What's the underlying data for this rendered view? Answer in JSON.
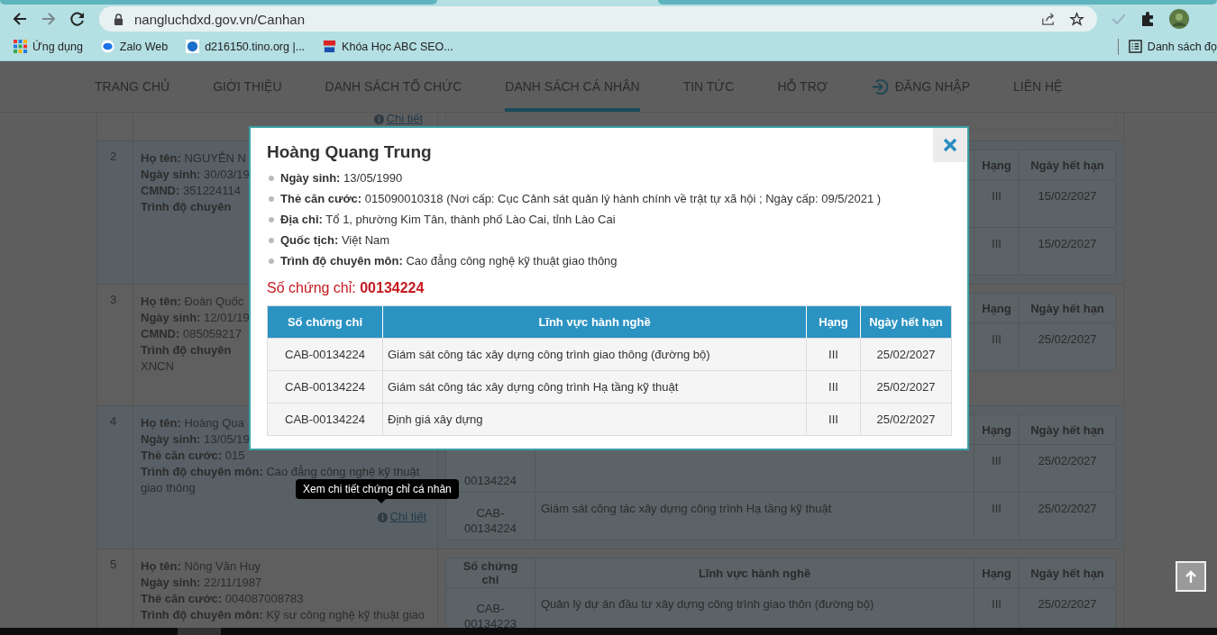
{
  "browser": {
    "url": "nangluchdxd.gov.vn/Canhan",
    "bookmarks": [
      {
        "label": "Ứng dụng",
        "kind": "apps"
      },
      {
        "label": "Zalo Web",
        "kind": "chat"
      },
      {
        "label": "d216150.tino.org |...",
        "kind": "site"
      },
      {
        "label": "Khóa Học ABC SEO...",
        "kind": "course"
      }
    ],
    "reading_list": "Danh sách đọ"
  },
  "nav": [
    {
      "label": "TRANG CHỦ",
      "selected": false
    },
    {
      "label": "GIỚI THIỆU",
      "selected": false
    },
    {
      "label": "DANH SÁCH TỔ CHỨC",
      "selected": false
    },
    {
      "label": "DANH SÁCH CÁ NHÂN",
      "selected": true
    },
    {
      "label": "TIN TỨC",
      "selected": false
    },
    {
      "label": "HỖ TRỢ",
      "selected": false
    },
    {
      "label": "ĐĂNG NHẬP",
      "selected": false,
      "kind": "login"
    },
    {
      "label": "LIÊN HỆ",
      "selected": false
    }
  ],
  "people": [
    {
      "link": "Chi tiết"
    },
    {
      "index": "2",
      "info": [
        "**Họ tên:** NGUYỄN N",
        "**Ngày sinh:** 30/03/19",
        "**CMND:** 351224114",
        "**Trình độ chuyên**"
      ],
      "certs": {
        "headers": {
          "grade": "Hạng",
          "expiry": "Ngày hết hạn"
        },
        "rows": [
          {
            "grade": "III",
            "expiry": "15/02/2027"
          },
          {
            "grade": "III",
            "expiry": "15/02/2027"
          }
        ]
      }
    },
    {
      "index": "3",
      "info": [
        "**Họ tên:** Đoàn Quốc",
        "**Ngày sinh:** 12/01/19",
        "**CMND:** 085059217",
        "**Trình độ chuyên**",
        "XNCN"
      ],
      "certs": {
        "headers": {
          "grade": "Hạng",
          "expiry": "Ngày hết hạn"
        },
        "rows": [
          {
            "grade": "III",
            "expiry": "25/02/2027"
          }
        ]
      }
    },
    {
      "index": "4",
      "info": [
        "**Họ tên:** Hoàng Qua",
        "**Ngày sinh:** 13/05/19",
        "**Thẻ căn cước:** 015",
        "**Trình độ chuyên môn:** Cao đẳng công nghệ kỹ thuật",
        "giao thông"
      ],
      "link": "Chi tiết",
      "certs": {
        "headers": {
          "grade": "Hạng",
          "expiry": "Ngày hết hạn"
        },
        "rows": [
          {
            "number_tail": "00134224",
            "grade": "III",
            "expiry": "25/02/2027"
          },
          {
            "number": "CAB-00134224",
            "field": "Giám sát công tác xây dựng công trình Hạ tầng kỹ thuật",
            "grade": "III",
            "expiry": "25/02/2027"
          }
        ]
      }
    },
    {
      "index": "5",
      "info": [
        "**Họ tên:** Nông Văn Huy",
        "**Ngày sinh:** 22/11/1987",
        "**Thẻ căn cước:** 004087008783",
        "**Trình độ chuyên môn:** Kỹ sư công nghệ kỹ thuật giao"
      ],
      "certs": {
        "headers": {
          "number": "Số chứng chỉ",
          "field": "Lĩnh vực hành nghề",
          "grade": "Hạng",
          "expiry": "Ngày hết hạn"
        },
        "rows": [
          {
            "number": "CAB-00134223",
            "field": "Quản lý dự án đầu tư xây dựng công trình giao thôn (đường bộ)",
            "grade": "III",
            "expiry": "25/02/2027"
          }
        ]
      }
    }
  ],
  "modal": {
    "title": "Hoàng Quang Trung",
    "details": [
      "**Ngày sinh:** 13/05/1990",
      "**Thẻ căn cước:** 015090010318 (Nơi cấp: Cục Cảnh sát quản lý hành chính về trật tự xã hội ; Ngày cấp: 09/5/2021 )",
      "**Địa chỉ:** Tổ 1, phường Kim Tân, thành phố Lào Cai, tỉnh Lào Cai",
      "**Quốc tịch:** Việt Nam",
      "**Trình độ chuyên môn:** Cao đẳng công nghệ kỹ thuật giao thông"
    ],
    "cert_number": "Số chứng chỉ: **00134224**",
    "columns": [
      "Số chứng chỉ",
      "Lĩnh vực hành nghề",
      "Hạng",
      "Ngày hết hạn"
    ],
    "rows": [
      [
        "CAB-00134224",
        "Giám sát công tác xây dựng công trình giao thông (đường bộ)",
        "III",
        "25/02/2027"
      ],
      [
        "CAB-00134224",
        "Giám sát công tác xây dựng công trình Hạ tầng kỹ thuật",
        "III",
        "25/02/2027"
      ],
      [
        "CAB-00134224",
        "Định giá xây dựng",
        "III",
        "25/02/2027"
      ]
    ]
  },
  "tooltip": "Xem chi tiết chứng chỉ cá nhân"
}
